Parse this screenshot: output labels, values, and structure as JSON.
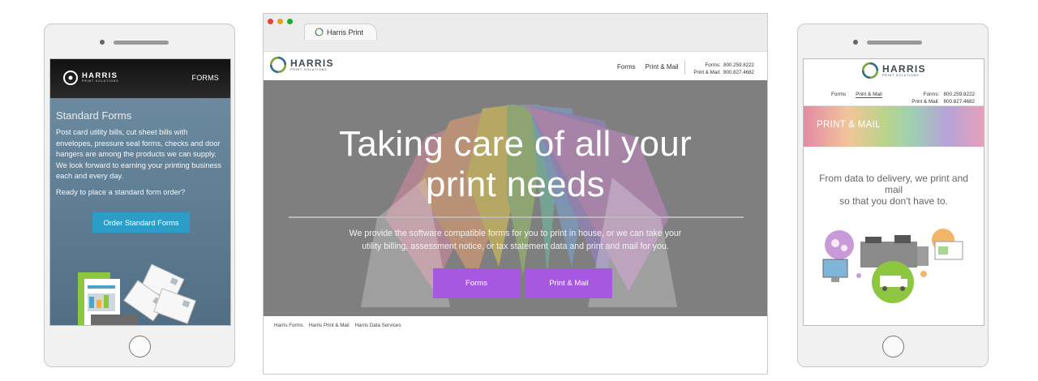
{
  "left_phone": {
    "brand": "HARRIS",
    "brand_sub": "PRINT SOLUTIONS",
    "nav_label": "FORMS",
    "title": "Standard Forms",
    "body": "Post card utility bills, cut sheet bills with envelopes, pressure seal forms, checks and door hangers are among the products we can supply. We look forward to earning your printing business each and every day.",
    "prompt": "Ready to place a standard form order?",
    "button_label": "Order Standard Forms"
  },
  "browser": {
    "tab_title": "Harris Print",
    "brand": "HARRIS",
    "brand_sub": "PRINT SOLUTIONS",
    "nav": [
      {
        "label": "Forms"
      },
      {
        "label": "Print & Mail"
      }
    ],
    "contact": [
      {
        "label": "Forms:",
        "phone": "800.259.8222"
      },
      {
        "label": "Print & Mail:",
        "phone": "800.827.4682"
      }
    ],
    "hero": {
      "title_line1": "Taking care of all your",
      "title_line2": "print needs",
      "description": "We provide the software compatible forms for you to print in house, or we can take your utility billing, assessment notice, or tax statement data and print and mail for you.",
      "button_forms": "Forms",
      "button_print_mail": "Print & Mail"
    },
    "footer_links": [
      {
        "label": "Harris Forms"
      },
      {
        "label": "Harris Print & Mail"
      },
      {
        "label": "Harris Data Services"
      }
    ],
    "colors": {
      "accent_purple": "#a659e0",
      "hero_gray": "#7f7f7f"
    }
  },
  "right_phone": {
    "brand": "HARRIS",
    "brand_sub": "PRINT SOLUTIONS",
    "nav": [
      {
        "label": "Forms"
      },
      {
        "label": "Print & Mail"
      }
    ],
    "contact": [
      {
        "label": "Forms:",
        "phone": "800.259.8222"
      },
      {
        "label": "Print & Mail:",
        "phone": "800.827.4682"
      }
    ],
    "banner_title": "PRINT & MAIL",
    "tagline_line1": "From data to delivery, we print and mail",
    "tagline_line2": "so that you don't have to."
  }
}
